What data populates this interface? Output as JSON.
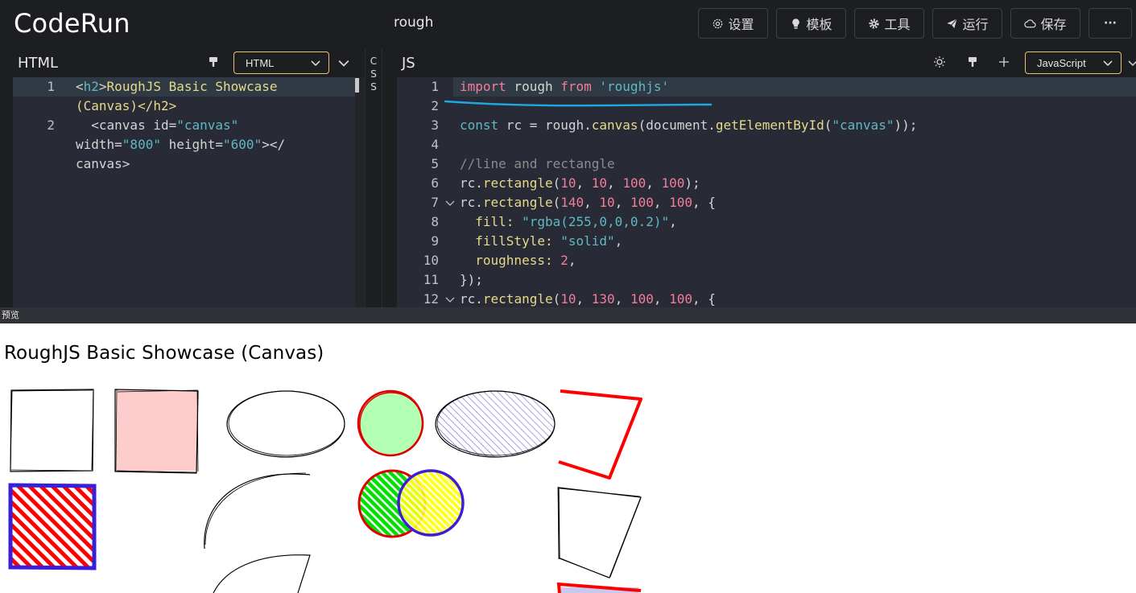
{
  "app": {
    "name": "CodeRun",
    "project_title": "rough"
  },
  "toolbar": {
    "settings_label": "设置",
    "templates_label": "模板",
    "tools_label": "工具",
    "run_label": "运行",
    "save_label": "保存",
    "more_label": "···"
  },
  "html_pane": {
    "title": "HTML",
    "language": "HTML",
    "line_numbers": [
      "1",
      "2"
    ],
    "code": {
      "l1a_open": "<",
      "l1a_tag": "h2",
      "l1a_close": ">",
      "l1a_text": "RoughJS Basic Showcase",
      "l1b_text": "(Canvas)",
      "l1b_end": "</h2>",
      "l2a_open": "  <canvas id=",
      "l2a_val": "\"canvas\"",
      "l2b_attr1": "width=",
      "l2b_val1": "\"800\"",
      "l2b_attr2": " height=",
      "l2b_val2": "\"600\"",
      "l2b_end": "></",
      "l2c_end": "canvas>"
    }
  },
  "css_strip": {
    "letters": [
      "C",
      "S",
      "S"
    ]
  },
  "js_pane": {
    "title": "JS",
    "language": "JavaScript",
    "line_numbers": [
      "1",
      "2",
      "3",
      "4",
      "5",
      "6",
      "7",
      "8",
      "9",
      "10",
      "11",
      "12"
    ],
    "lines": {
      "l1_import": "import",
      "l1_rough": " rough ",
      "l1_from": "from",
      "l1_str": " 'roughjs'",
      "l3_const": "const",
      "l3_rc": " rc = rough.",
      "l3_canvas": "canvas",
      "l3_doc": "(document.",
      "l3_getel": "getElementById",
      "l3_open": "(",
      "l3_str": "\"canvas\"",
      "l3_close": "));",
      "l5_comment": "//line and rectangle",
      "l6_rc": "rc.",
      "l6_fn": "rectangle",
      "l6_open": "(",
      "l6_a": "10",
      "l6_b": "10",
      "l6_c": "100",
      "l6_d": "100",
      "l6_close": ");",
      "l7_rc": "rc.",
      "l7_fn": "rectangle",
      "l7_a": "140",
      "l7_b": "10",
      "l7_c": "100",
      "l7_d": "100",
      "l7_close": ", {",
      "l8_key": "  fill: ",
      "l8_val": "\"rgba(255,0,0,0.2)\"",
      "l8_end": ",",
      "l9_key": "  fillStyle: ",
      "l9_val": "\"solid\"",
      "l9_end": ",",
      "l10_key": "  roughness: ",
      "l10_val": "2",
      "l10_end": ",",
      "l11": "});",
      "l12_rc": "rc.",
      "l12_fn": "rectangle",
      "l12_a": "10",
      "l12_b": "130",
      "l12_c": "100",
      "l12_d": "100",
      "l12_close": ", {"
    }
  },
  "preview": {
    "label": "预览",
    "heading": "RoughJS Basic Showcase (Canvas)"
  },
  "colors": {
    "accent_border": "#e8c16e",
    "annotation_underline": "#1fa7e0"
  }
}
